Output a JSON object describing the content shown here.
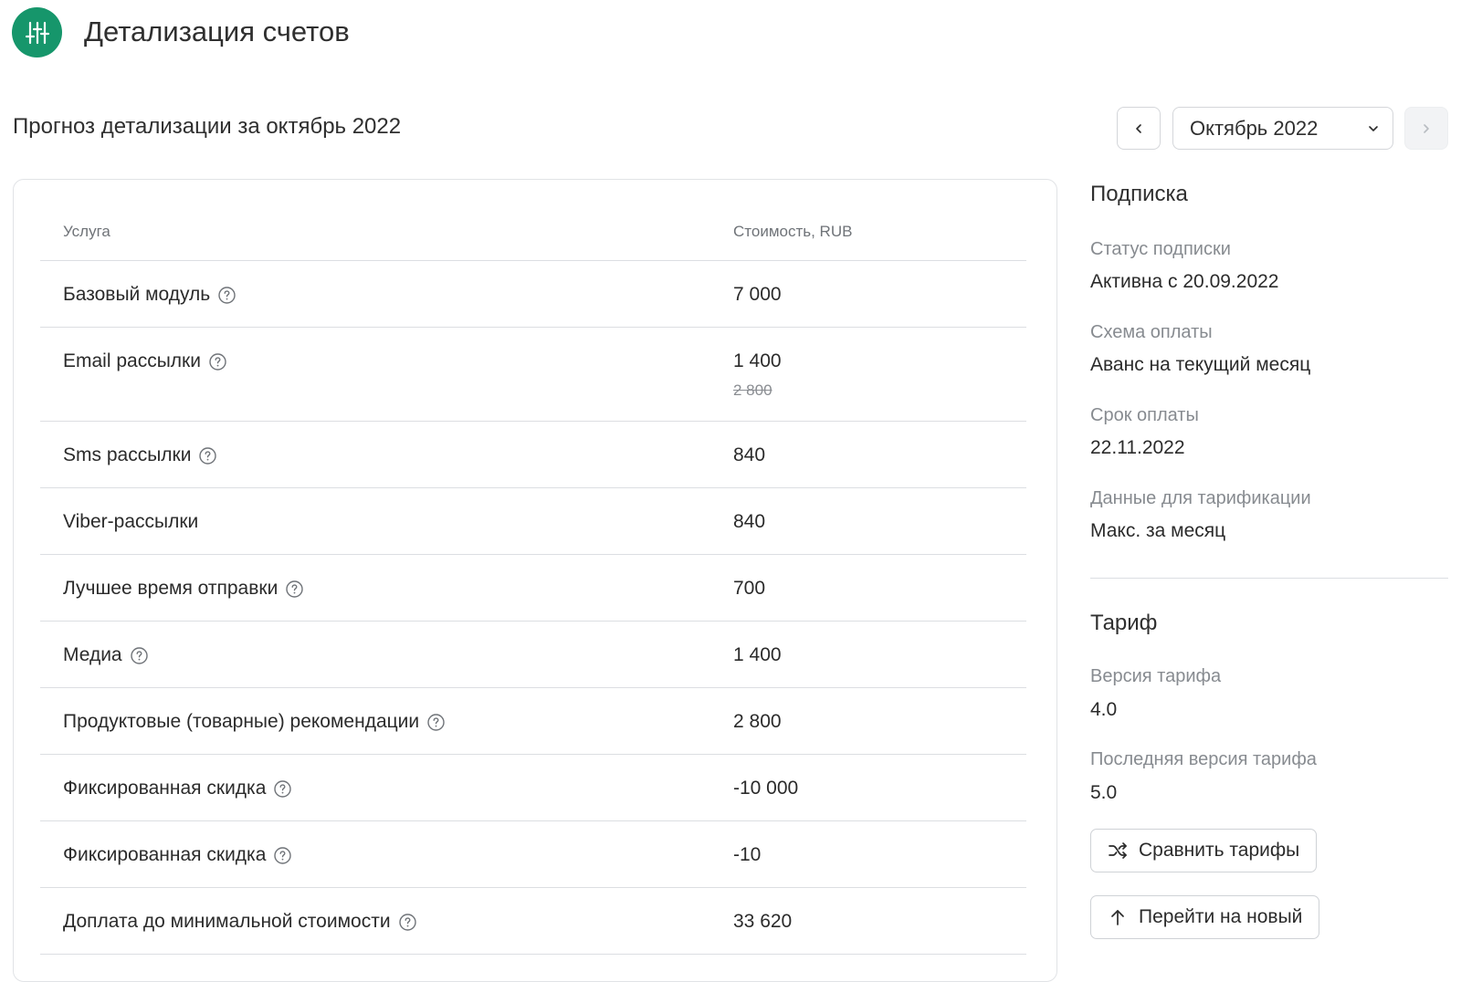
{
  "header": {
    "title": "Детализация счетов",
    "logo_icon": "sliders-icon",
    "brand_color": "#16966b"
  },
  "period": {
    "title": "Прогноз детализации за октябрь 2022",
    "selected_month": "Октябрь 2022",
    "prev_icon": "chevron-left-icon",
    "next_icon": "chevron-right-icon",
    "next_disabled": true
  },
  "table": {
    "headers": {
      "service": "Услуга",
      "cost": "Стоимость, RUB"
    },
    "rows": [
      {
        "service": "Базовый модуль",
        "cost": "7 000",
        "help": true
      },
      {
        "service": "Email рассылки",
        "cost": "1 400",
        "old_cost": "2 800",
        "help": true
      },
      {
        "service": "Sms рассылки",
        "cost": "840",
        "help": true
      },
      {
        "service": "Viber-рассылки",
        "cost": "840",
        "help": false
      },
      {
        "service": "Лучшее время отправки",
        "cost": "700",
        "help": true
      },
      {
        "service": "Медиа",
        "cost": "1 400",
        "help": true
      },
      {
        "service": "Продуктовые (товарные) рекомендации",
        "cost": "2 800",
        "help": true
      },
      {
        "service": "Фиксированная скидка",
        "cost": "-10 000",
        "help": true
      },
      {
        "service": "Фиксированная скидка",
        "cost": "-10",
        "help": true
      },
      {
        "service": "Доплата до минимальной стоимости",
        "cost": "33 620",
        "help": true
      }
    ]
  },
  "subscription": {
    "title": "Подписка",
    "status_label": "Статус подписки",
    "status_value": "Активна с 20.09.2022",
    "scheme_label": "Схема оплаты",
    "scheme_value": "Аванс на текущий месяц",
    "due_label": "Срок оплаты",
    "due_value": "22.11.2022",
    "billing_label": "Данные для тарификации",
    "billing_value": "Макс. за месяц"
  },
  "tariff": {
    "title": "Тариф",
    "version_label": "Версия тарифа",
    "version_value": "4.0",
    "latest_label": "Последняя версия тарифа",
    "latest_value": "5.0",
    "compare_button": "Сравнить тарифы",
    "upgrade_button": "Перейти на новый"
  }
}
